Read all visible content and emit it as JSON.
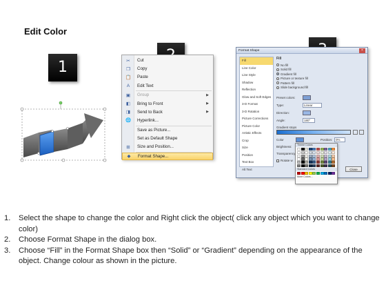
{
  "title": "Edit Color",
  "step_numbers": [
    "1",
    "2",
    "3"
  ],
  "context_menu": {
    "items": [
      {
        "label": "Cut",
        "icon": "scissors-icon",
        "glyph": "✂",
        "submenu": false,
        "disabled": false
      },
      {
        "label": "Copy",
        "icon": "copy-icon",
        "glyph": "❐",
        "submenu": false,
        "disabled": false
      },
      {
        "label": "Paste",
        "icon": "paste-icon",
        "glyph": "📋",
        "submenu": false,
        "disabled": false
      },
      {
        "label": "Edit Text",
        "icon": "edit-text-icon",
        "glyph": "A",
        "submenu": false,
        "disabled": false
      },
      {
        "label": "Group",
        "icon": "group-icon",
        "glyph": "▣",
        "submenu": true,
        "disabled": true
      },
      {
        "label": "Bring to Front",
        "icon": "bring-front-icon",
        "glyph": "◧",
        "submenu": true,
        "disabled": false
      },
      {
        "label": "Send to Back",
        "icon": "send-back-icon",
        "glyph": "◨",
        "submenu": true,
        "disabled": false
      },
      {
        "label": "Hyperlink...",
        "icon": "hyperlink-icon",
        "glyph": "🌐",
        "submenu": false,
        "disabled": false
      },
      {
        "label": "Save as Picture...",
        "icon": "",
        "glyph": "",
        "submenu": false,
        "disabled": false
      },
      {
        "label": "Set as Default Shape",
        "icon": "",
        "glyph": "",
        "submenu": false,
        "disabled": false
      },
      {
        "label": "Size and Position...",
        "icon": "size-position-icon",
        "glyph": "⊞",
        "submenu": false,
        "disabled": false
      },
      {
        "label": "Format Shape...",
        "icon": "format-shape-icon",
        "glyph": "◆",
        "submenu": false,
        "disabled": false
      }
    ],
    "highlighted": "Format Shape..."
  },
  "format_dialog": {
    "title": "Format Shape",
    "categories": [
      "Fill",
      "Line Color",
      "Line Style",
      "Shadow",
      "Reflection",
      "Glow and Soft Edges",
      "3-D Format",
      "3-D Rotation",
      "Picture Corrections",
      "Picture Color",
      "Artistic Effects",
      "Crop",
      "Size",
      "Position",
      "Text Box",
      "Alt Text"
    ],
    "selected_category": "Fill",
    "heading": "Fill",
    "fill_options": [
      {
        "label": "No fill",
        "selected": false
      },
      {
        "label": "Solid fill",
        "selected": false
      },
      {
        "label": "Gradient fill",
        "selected": true
      },
      {
        "label": "Picture or texture fill",
        "selected": false
      },
      {
        "label": "Pattern fill",
        "selected": false
      },
      {
        "label": "Slide background fill",
        "selected": false
      }
    ],
    "preset_colors_label": "Preset colors:",
    "type_label": "Type:",
    "type_value": "Linear",
    "direction_label": "Direction:",
    "angle_label": "Angle:",
    "angle_value": "180°",
    "gradient_stops_label": "Gradient stops",
    "color_label": "Color",
    "position_label": "Position:",
    "position_value": "0%",
    "brightness_label": "Brightness:",
    "transparency_label": "Transparency:",
    "rotate_label": "Rotate w",
    "close_label": "Close"
  },
  "color_palette": {
    "theme_label": "Theme Colors",
    "standard_label": "Standard Colors",
    "more_label": "More Colors...",
    "theme_top": [
      "#ffffff",
      "#000000",
      "#eeece1",
      "#1f497d",
      "#4f81bd",
      "#c0504d",
      "#9bbb59",
      "#8064a2",
      "#4bacc6",
      "#f79646"
    ],
    "standard": [
      "#c00000",
      "#ff0000",
      "#ffc000",
      "#ffff00",
      "#92d050",
      "#00b050",
      "#00b0f0",
      "#0070c0",
      "#002060",
      "#7030a0"
    ]
  },
  "instructions": [
    {
      "num": "1.",
      "text": "Select the shape to change the color and Right click the object( click any object which you want to change color)"
    },
    {
      "num": "2.",
      "text": "Choose Format Shape in the dialog box."
    },
    {
      "num": "3.",
      "text": "Choose “Fill” in the Format Shape box then “Solid” or “Gradient” depending on the appearance of the object. Change colour as shown in the picture."
    }
  ],
  "colors": {
    "selected_segment": "#2a74d6",
    "arrow_gray": "#6b6b6b",
    "highlight": "#f9d36a"
  }
}
